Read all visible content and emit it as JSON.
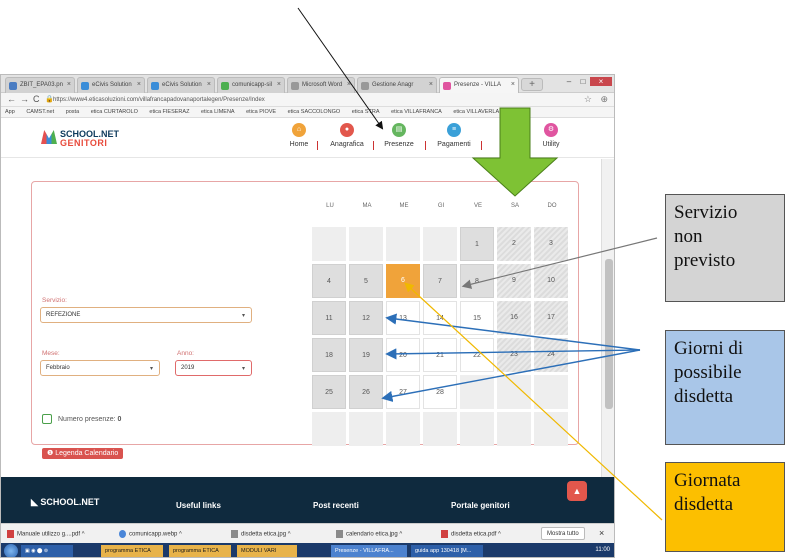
{
  "browser": {
    "tabs": [
      {
        "label": "ZBIT_EPA03.pn"
      },
      {
        "label": "eCivis Solution"
      },
      {
        "label": "eCivis Solution"
      },
      {
        "label": "comunicapp-sil"
      },
      {
        "label": "Microsoft Word"
      },
      {
        "label": "Gestione Anagr"
      },
      {
        "label": "Presenze - VILLA"
      }
    ],
    "url": "https://www4.eticasoluzioni.com/villafrancapadovanaportalegen/Presenze/Index",
    "bookmarks": [
      "App",
      "CAMST.net",
      "posta",
      "etica CURTAROLO",
      "etica FIESERAZ",
      "etica LIMENA",
      "etica PIOVE",
      "etica SACCOLONGO",
      "etica STRA",
      "etica VILLAFRANCA",
      "etica VILLAVERLA"
    ]
  },
  "site": {
    "logo_line1": "SCHOOL.NET",
    "logo_line2": "GENITORI",
    "nav": [
      {
        "label": "Home",
        "icon": "home-icon",
        "color": "#f0a33a"
      },
      {
        "label": "Anagrafica",
        "icon": "user-icon",
        "color": "#e2574c"
      },
      {
        "label": "Presenze",
        "icon": "calendar-icon",
        "color": "#65b65f"
      },
      {
        "label": "Pagamenti",
        "icon": "card-icon",
        "color": "#3aa0d8"
      },
      {
        "label": "Utility",
        "icon": "tools-icon",
        "color": "#e055a0"
      }
    ]
  },
  "form": {
    "servizio_label": "Servizio:",
    "servizio_value": "REFEZIONE",
    "mese_label": "Mese:",
    "mese_value": "Febbraio",
    "anno_label": "Anno:",
    "anno_value": "2019",
    "presenze_label": "Numero presenze:",
    "presenze_value": "0",
    "legend_button": "Legenda Calendario"
  },
  "calendar": {
    "weekdays": [
      "LU",
      "MA",
      "ME",
      "GI",
      "VE",
      "SA",
      "DO"
    ],
    "days": [
      {
        "label": "",
        "style": "empty"
      },
      {
        "label": "",
        "style": "empty"
      },
      {
        "label": "",
        "style": "empty"
      },
      {
        "label": "",
        "style": "empty"
      },
      {
        "label": "1",
        "style": "grey"
      },
      {
        "label": "2",
        "style": "hatch"
      },
      {
        "label": "3",
        "style": "hatch"
      },
      {
        "label": "4",
        "style": "grey"
      },
      {
        "label": "5",
        "style": "grey"
      },
      {
        "label": "6",
        "style": "orange"
      },
      {
        "label": "7",
        "style": "grey"
      },
      {
        "label": "8",
        "style": "grey"
      },
      {
        "label": "9",
        "style": "hatch"
      },
      {
        "label": "10",
        "style": "hatch"
      },
      {
        "label": "11",
        "style": "grey"
      },
      {
        "label": "12",
        "style": "grey"
      },
      {
        "label": "13",
        "style": "white"
      },
      {
        "label": "14",
        "style": "white"
      },
      {
        "label": "15",
        "style": "white"
      },
      {
        "label": "16",
        "style": "hatch"
      },
      {
        "label": "17",
        "style": "hatch"
      },
      {
        "label": "18",
        "style": "grey"
      },
      {
        "label": "19",
        "style": "grey"
      },
      {
        "label": "20",
        "style": "white"
      },
      {
        "label": "21",
        "style": "white"
      },
      {
        "label": "22",
        "style": "white"
      },
      {
        "label": "23",
        "style": "hatch"
      },
      {
        "label": "24",
        "style": "hatch"
      },
      {
        "label": "25",
        "style": "grey"
      },
      {
        "label": "26",
        "style": "grey"
      },
      {
        "label": "27",
        "style": "white"
      },
      {
        "label": "28",
        "style": "white"
      },
      {
        "label": "",
        "style": "empty"
      },
      {
        "label": "",
        "style": "empty"
      },
      {
        "label": "",
        "style": "empty"
      },
      {
        "label": "",
        "style": "empty"
      },
      {
        "label": "",
        "style": "empty"
      },
      {
        "label": "",
        "style": "empty"
      },
      {
        "label": "",
        "style": "empty"
      },
      {
        "label": "",
        "style": "empty"
      },
      {
        "label": "",
        "style": "empty"
      },
      {
        "label": "",
        "style": "empty"
      }
    ]
  },
  "footer": {
    "logo": "SCHOOL.NET",
    "useful_links": "Useful links",
    "post_recenti": "Post recenti",
    "portale_genitori": "Portale genitori"
  },
  "downloads": [
    {
      "name": "Manuale utilizzo g....pdf"
    },
    {
      "name": "comunicapp.webp"
    },
    {
      "name": "disdetta etica.jpg"
    },
    {
      "name": "calendario etica.jpg"
    },
    {
      "name": "disdetta etica.pdf"
    }
  ],
  "downloads_show_all": "Mostra tutto",
  "taskbar": {
    "items": [
      "programma ETICA",
      "programma ETICA",
      "MODULI VARI",
      "Presenze - VILLAFRA...",
      "guida app 130418 [M..."
    ],
    "clock": "11:00"
  },
  "annotations": {
    "servizio_non_previsto": [
      "Servizio",
      "non",
      "previsto"
    ],
    "giorni_disdetta": [
      "Giorni di",
      "possibile",
      "disdetta"
    ],
    "giornata_disdetta": [
      "Giornata",
      "disdetta"
    ]
  },
  "colors": {
    "accent_green": "#7ec234",
    "callout_grey": "#d4d4d4",
    "callout_blue": "#a9c6e8",
    "callout_yellow": "#fcbf00",
    "arrow_blue": "#2c6fb8",
    "arrow_grey": "#777777",
    "arrow_yellow": "#f0b800"
  }
}
